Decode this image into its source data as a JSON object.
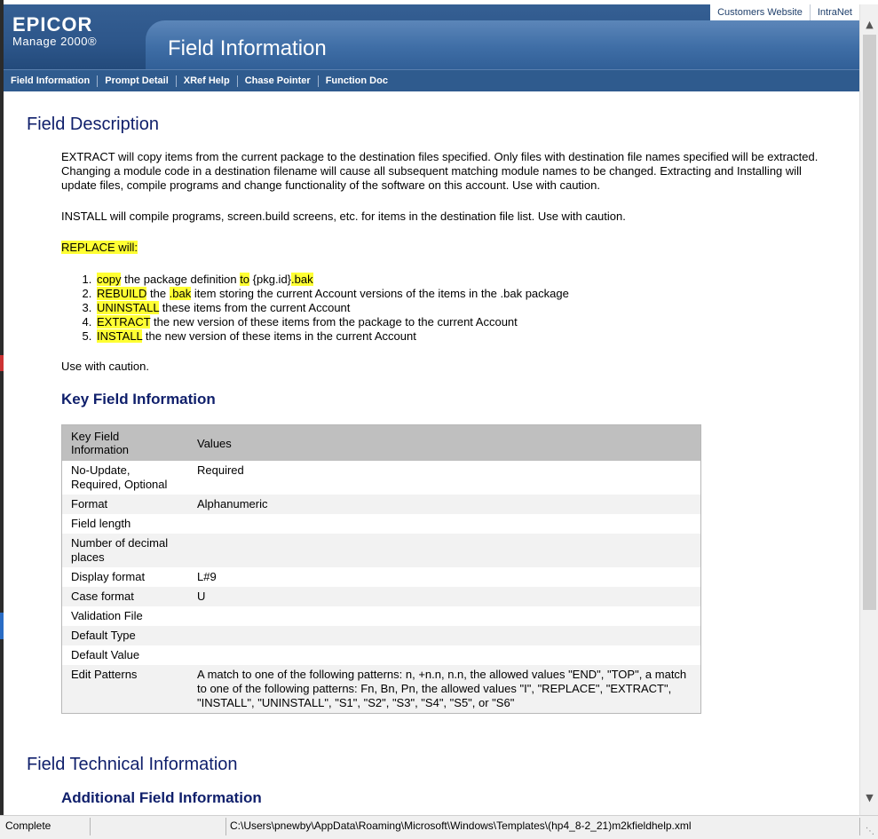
{
  "header": {
    "brand": "EPICOR",
    "product": "Manage 2000®",
    "title": "Field Information",
    "top_links": [
      "Customers Website",
      "IntraNet"
    ],
    "nav": [
      "Field Information",
      "Prompt Detail",
      "XRef Help",
      "Chase Pointer",
      "Function Doc"
    ]
  },
  "content": {
    "field_description_heading": "Field Description",
    "para_extract": "EXTRACT will copy items from the current package to the destination files specified. Only files with destination file names specified will be extracted. Changing a module code in a destination filename will cause all subsequent matching module names to be changed. Extracting and Installing will update files, compile programs and change functionality of the software on this account. Use with caution.",
    "para_install": "INSTALL will compile programs, screen.build screens, etc. for items in the destination file list. Use with caution.",
    "replace_label": "REPLACE will:",
    "steps": [
      {
        "hl": "copy",
        "rest": " the package definition ",
        "hl2": "to",
        "rest2": " {pkg.id}",
        "hl3": ".bak",
        "rest3": ""
      },
      {
        "hl": "REBUILD",
        "rest": " the ",
        "hl2": ".bak",
        "rest2": " item storing the current Account versions of the items in the .bak package",
        "hl3": "",
        "rest3": ""
      },
      {
        "hl": "UNINSTALL",
        "rest": " these items from the current Account",
        "hl2": "",
        "rest2": "",
        "hl3": "",
        "rest3": ""
      },
      {
        "hl": "EXTRACT",
        "rest": " the new version of these items from the package to the current Account",
        "hl2": "",
        "rest2": "",
        "hl3": "",
        "rest3": ""
      },
      {
        "hl": "INSTALL",
        "rest": " the new version of these items in the current Account",
        "hl2": "",
        "rest2": "",
        "hl3": "",
        "rest3": ""
      }
    ],
    "use_with_caution": "Use with caution.",
    "key_field_heading": "Key Field Information",
    "table": {
      "headers": [
        "Key Field Information",
        "Values"
      ],
      "rows": [
        [
          "No-Update, Required, Optional",
          "Required"
        ],
        [
          "Format",
          "Alphanumeric"
        ],
        [
          "Field length",
          ""
        ],
        [
          "Number of decimal places",
          ""
        ],
        [
          "Display format",
          "L#9"
        ],
        [
          "Case format",
          "U"
        ],
        [
          "Validation File",
          ""
        ],
        [
          "Default Type",
          ""
        ],
        [
          "Default Value",
          ""
        ],
        [
          "Edit Patterns",
          "A match to one of the following patterns: n, +n.n, n.n, the allowed values \"END\", \"TOP\", a match to one of the following patterns: Fn, Bn, Pn, the allowed values \"I\", \"REPLACE\", \"EXTRACT\", \"INSTALL\", \"UNINSTALL\", \"S1\", \"S2\", \"S3\", \"S4\", \"S5\", or \"S6\""
        ]
      ]
    },
    "tech_heading": "Field Technical Information",
    "additional_heading": "Additional Field Information"
  },
  "statusbar": {
    "status": "Complete",
    "path": "C:\\Users\\pnewby\\AppData\\Roaming\\Microsoft\\Windows\\Templates\\(hp4_8-2_21)m2kfieldhelp.xml"
  },
  "colors": {
    "header_blue": "#2f5b8e",
    "heading_navy": "#0f1f6b",
    "highlight": "#ffff33"
  },
  "icons": {
    "scroll_up": "chevron-up-icon",
    "scroll_down": "chevron-down-icon"
  }
}
